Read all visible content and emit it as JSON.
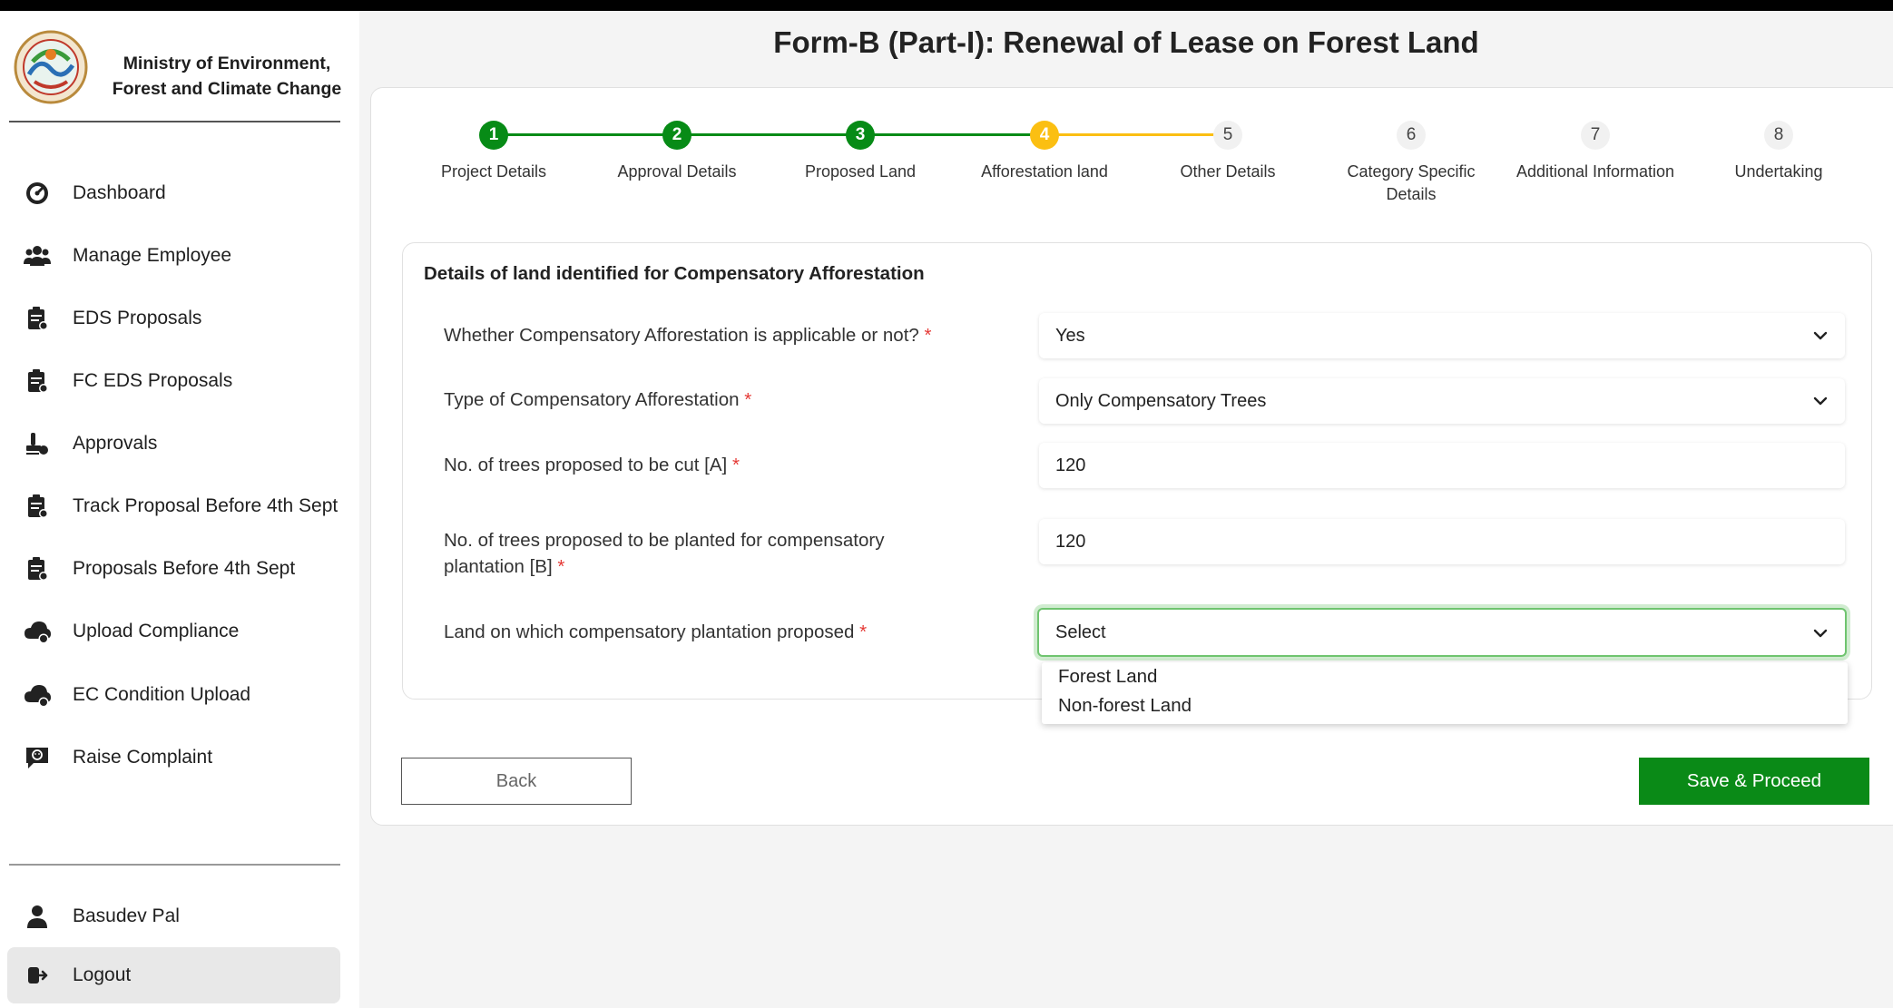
{
  "org": {
    "name_line1": "Ministry of Environment,",
    "name_line2": "Forest and Climate Change"
  },
  "sidebar": {
    "items": [
      {
        "label": "Dashboard",
        "icon": "dashboard-icon"
      },
      {
        "label": "Manage Employee",
        "icon": "users-icon"
      },
      {
        "label": "EDS Proposals",
        "icon": "clipboard-icon"
      },
      {
        "label": "FC EDS Proposals",
        "icon": "clipboard-icon"
      },
      {
        "label": "Approvals",
        "icon": "stamp-icon"
      },
      {
        "label": "Track Proposal Before 4th Sept",
        "icon": "clipboard-icon"
      },
      {
        "label": "Proposals Before 4th Sept",
        "icon": "clipboard-icon"
      },
      {
        "label": "Upload Compliance",
        "icon": "cloud-upload-icon"
      },
      {
        "label": "EC Condition Upload",
        "icon": "cloud-upload-icon"
      },
      {
        "label": "Raise Complaint",
        "icon": "complaint-icon"
      }
    ],
    "user_name": "Basudev Pal",
    "logout_label": "Logout"
  },
  "page": {
    "title": "Form-B (Part-I): Renewal of Lease on Forest Land"
  },
  "stepper": {
    "steps": [
      {
        "number": "1",
        "label": "Project Details",
        "state": "done"
      },
      {
        "number": "2",
        "label": "Approval Details",
        "state": "done"
      },
      {
        "number": "3",
        "label": "Proposed Land",
        "state": "done"
      },
      {
        "number": "4",
        "label": "Afforestation land",
        "state": "active"
      },
      {
        "number": "5",
        "label": "Other Details",
        "state": "pending"
      },
      {
        "number": "6",
        "label": "Category Specific Details",
        "state": "pending"
      },
      {
        "number": "7",
        "label": "Additional Information",
        "state": "pending"
      },
      {
        "number": "8",
        "label": "Undertaking",
        "state": "pending"
      }
    ]
  },
  "form": {
    "section_title": "Details of land identified for Compensatory Afforestation",
    "required_mark": "*",
    "fields": [
      {
        "label": "Whether Compensatory Afforestation is applicable or not?",
        "value": "Yes",
        "type": "select"
      },
      {
        "label": "Type of Compensatory Afforestation",
        "value": "Only Compensatory Trees",
        "type": "select"
      },
      {
        "label": "No. of trees proposed to be cut [A]",
        "value": "120",
        "type": "input"
      },
      {
        "label": "No. of trees proposed to be planted for compensatory plantation [B]",
        "value": "120",
        "type": "input"
      },
      {
        "label": "Land on which compensatory plantation proposed",
        "value": "Select",
        "type": "select"
      }
    ],
    "dropdown_options": [
      "Forest Land",
      "Non-forest Land"
    ]
  },
  "actions": {
    "back_label": "Back",
    "save_label": "Save & Proceed"
  },
  "colors": {
    "done": "#078b16",
    "active": "#fbbf12",
    "pending": "#f1f1f1",
    "primary_button": "#0a8a17"
  }
}
